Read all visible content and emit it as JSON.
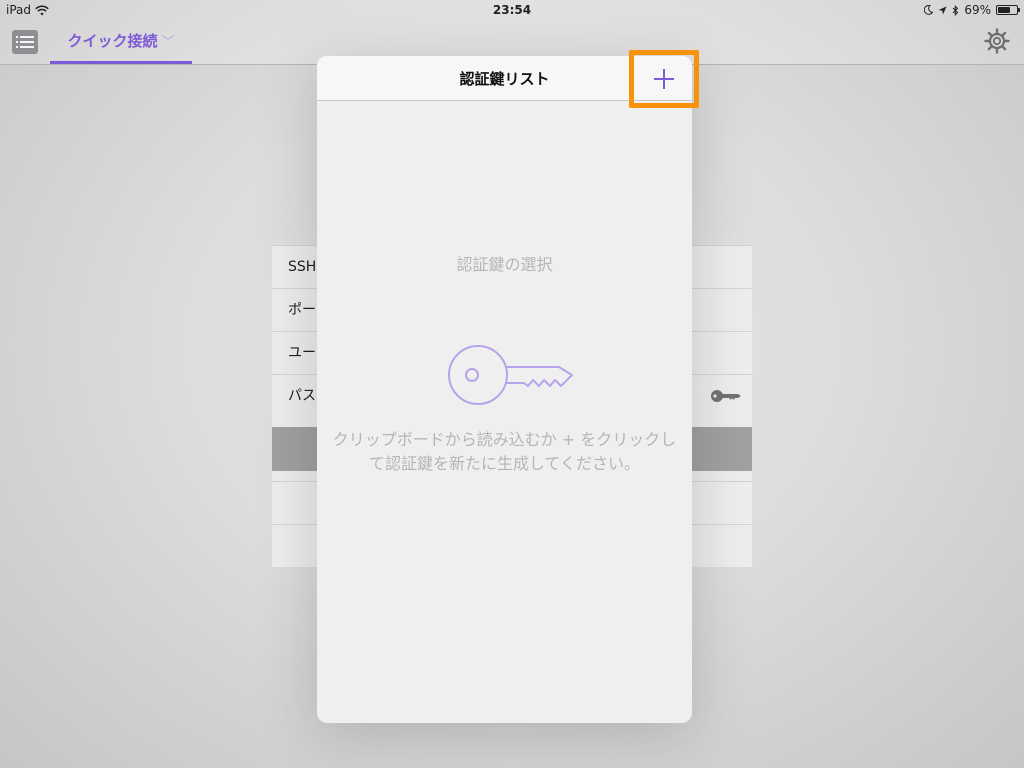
{
  "status_bar": {
    "device": "iPad",
    "time": "23:54",
    "battery": "69%",
    "battery_level": 0.69
  },
  "nav": {
    "tab_label": "クイック接続",
    "tab_chevron": "﹀"
  },
  "form": {
    "rows": [
      "SSH",
      "ポー",
      "ユー",
      "パス"
    ]
  },
  "popover": {
    "title": "認証鍵リスト",
    "add_label": "+",
    "empty_heading": "認証鍵の選択",
    "empty_message": "クリップボードから読み込むか + をクリックして認証鍵を新たに生成してください。"
  },
  "colors": {
    "accent": "#7d5ad6",
    "highlight_border": "#f7920a"
  },
  "icons": {
    "menu": "list-icon",
    "settings": "gear-icon",
    "key": "key-icon",
    "wifi": "wifi-icon"
  }
}
